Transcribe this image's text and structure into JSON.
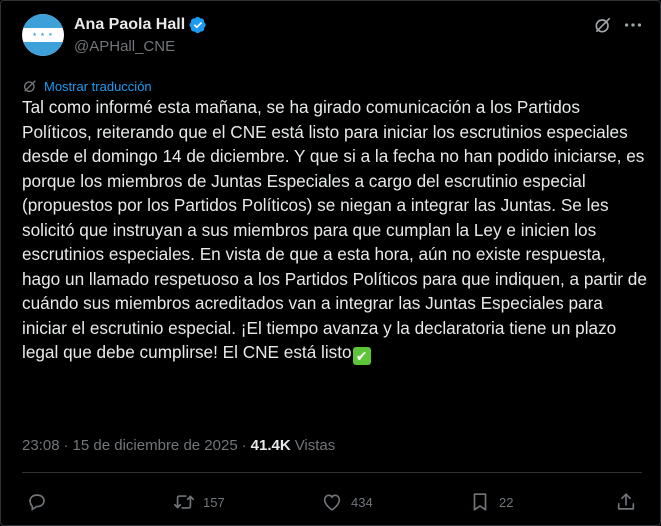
{
  "author": {
    "name": "Ana Paola Hall",
    "handle": "@APHall_CNE",
    "verified_color": "#1d9bf0",
    "avatar_icon": "honduras-flag-avatar"
  },
  "header_icons": {
    "grok": "grok-icon",
    "more": "more-icon"
  },
  "translate": {
    "label": "Mostrar traducción",
    "icon": "grok-icon"
  },
  "tweet": {
    "text": "Tal como informé esta mañana, se ha girado comunicación a los Partidos Políticos, reiterando que el CNE está listo para iniciar los escrutinios especiales desde el domingo 14 de diciembre. Y que si a la fecha no han podido iniciarse, es porque los miembros de Juntas Especiales a cargo del escrutinio especial (propuestos por los Partidos Políticos) se niegan a integrar las Juntas. Se les solicitó que instruyan a sus miembros para que cumplan la Ley e inicien los escrutinios especiales. En vista de que a esta hora, aún no existe respuesta, hago un llamado respetuoso a los Partidos Políticos para que indiquen, a partir de cuándo sus miembros acreditados van a integrar las Juntas Especiales para iniciar el escrutinio especial. ¡El tiempo avanza y la declaratoria tiene un plazo legal que debe cumplirse! El CNE está listo",
    "emoji": "✔"
  },
  "meta": {
    "time": "23:08",
    "separator": "·",
    "date": "15 de diciembre de 2025",
    "views_count": "41.4K",
    "views_label": "Vistas"
  },
  "actions": {
    "reply_count": "",
    "retweet_count": "157",
    "like_count": "434",
    "bookmark_count": "22"
  },
  "colors": {
    "background": "#000000",
    "text": "#e7e9ea",
    "secondary": "#71767b",
    "accent": "#1d9bf0",
    "border": "#2f3336"
  }
}
